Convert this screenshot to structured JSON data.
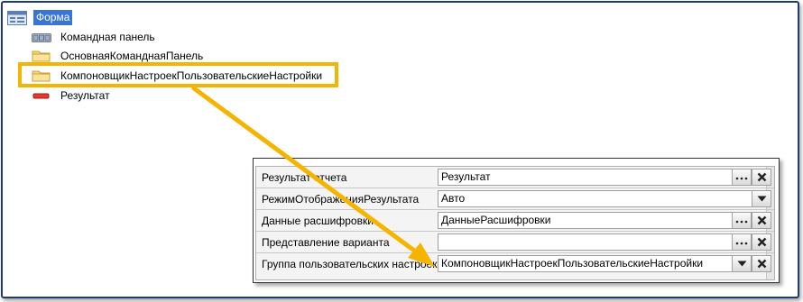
{
  "tree": {
    "root_label": "Форма",
    "items": [
      {
        "label": "Командная панель",
        "icon": "command-panel-icon"
      },
      {
        "label": "ОсновнаяКоманднаяПанель",
        "icon": "folder-icon"
      },
      {
        "label": "КомпоновщикНастроекПользовательскиеНастройки",
        "icon": "folder-icon"
      },
      {
        "label": "Результат",
        "icon": "field-icon"
      }
    ]
  },
  "properties": {
    "rows": [
      {
        "label": "Результат отчета",
        "value": "Результат"
      },
      {
        "label": "РежимОтображенияРезультата",
        "value": "Авто"
      },
      {
        "label": "Данные расшифровки",
        "value": "ДанныеРасшифровки"
      },
      {
        "label": "Представление варианта",
        "value": ""
      },
      {
        "label": "Группа пользовательских настроек",
        "value": "КомпоновщикНастроекПользовательскиеНастройки"
      }
    ]
  },
  "colors": {
    "highlight": "#f5b400",
    "selection": "#3875d7",
    "frame": "#1f3b70"
  }
}
